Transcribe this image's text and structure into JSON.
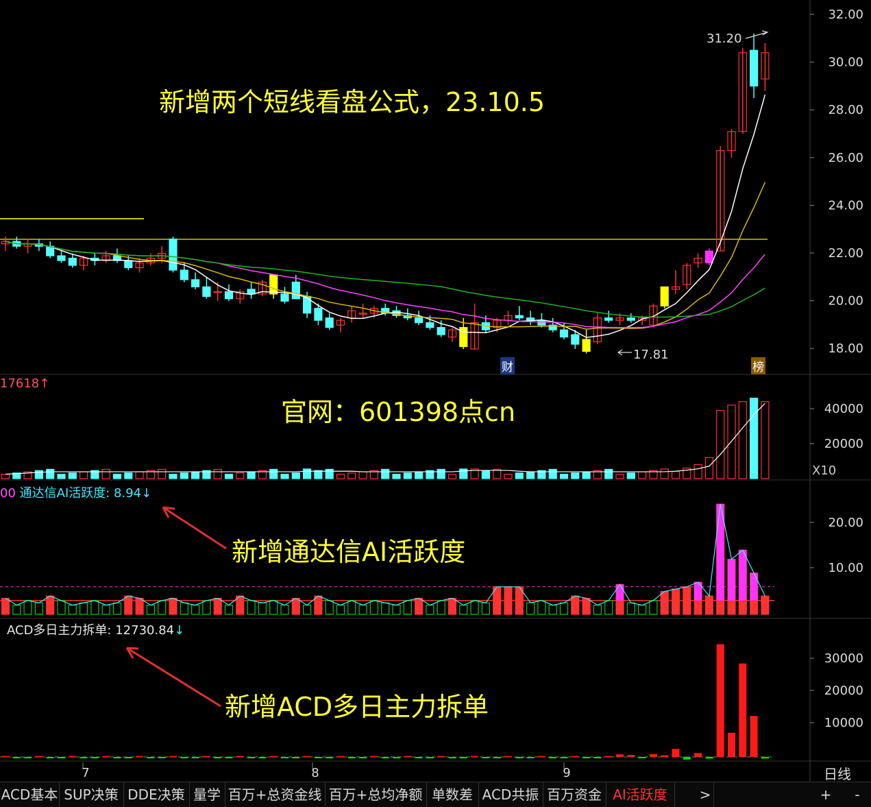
{
  "annotations": {
    "title": "新增两个短线看盘公式，23.10.5",
    "site": "官网：601398点cn",
    "note_ai": "新增通达信AI活跃度",
    "note_acd": "新增ACD多日主力拆单"
  },
  "price_panel": {
    "y_ticks": [
      "32.00",
      "30.00",
      "28.00",
      "26.00",
      "24.00",
      "22.00",
      "20.00",
      "18.00"
    ],
    "high_label": "31.20",
    "low_label": "17.81",
    "marker_cai": "财",
    "marker_bang": "榜"
  },
  "volume_panel": {
    "readout": "17618",
    "y_ticks": [
      "40000",
      "20000"
    ],
    "scale_label": "X10"
  },
  "ai_panel": {
    "prefix": "00",
    "readout": "通达信AI活跃度: 8.94",
    "y_ticks": [
      "20.00",
      "10.00"
    ]
  },
  "acd_panel": {
    "readout": "ACD多日主力拆单: 12730.84",
    "y_ticks": [
      "30000",
      "20000",
      "10000"
    ]
  },
  "x_axis": {
    "labels": [
      "7",
      "8",
      "9"
    ],
    "period": "日线"
  },
  "tabs": [
    "ACD基本",
    "SUP决策",
    "DDE决策",
    "量学",
    "百万+总资金线",
    "百万+总均净额",
    "单数差",
    "ACD共振",
    "百万资金",
    "AI活跃度"
  ],
  "tab_buttons": {
    "next": ">",
    "plus": "+",
    "minus": "-"
  },
  "colors": {
    "up": "#ff3232",
    "down": "#54ffff",
    "yellow": "#ffff00",
    "magenta": "#ff33ff",
    "green": "#00c800",
    "tab_active": "#ff3333"
  }
}
